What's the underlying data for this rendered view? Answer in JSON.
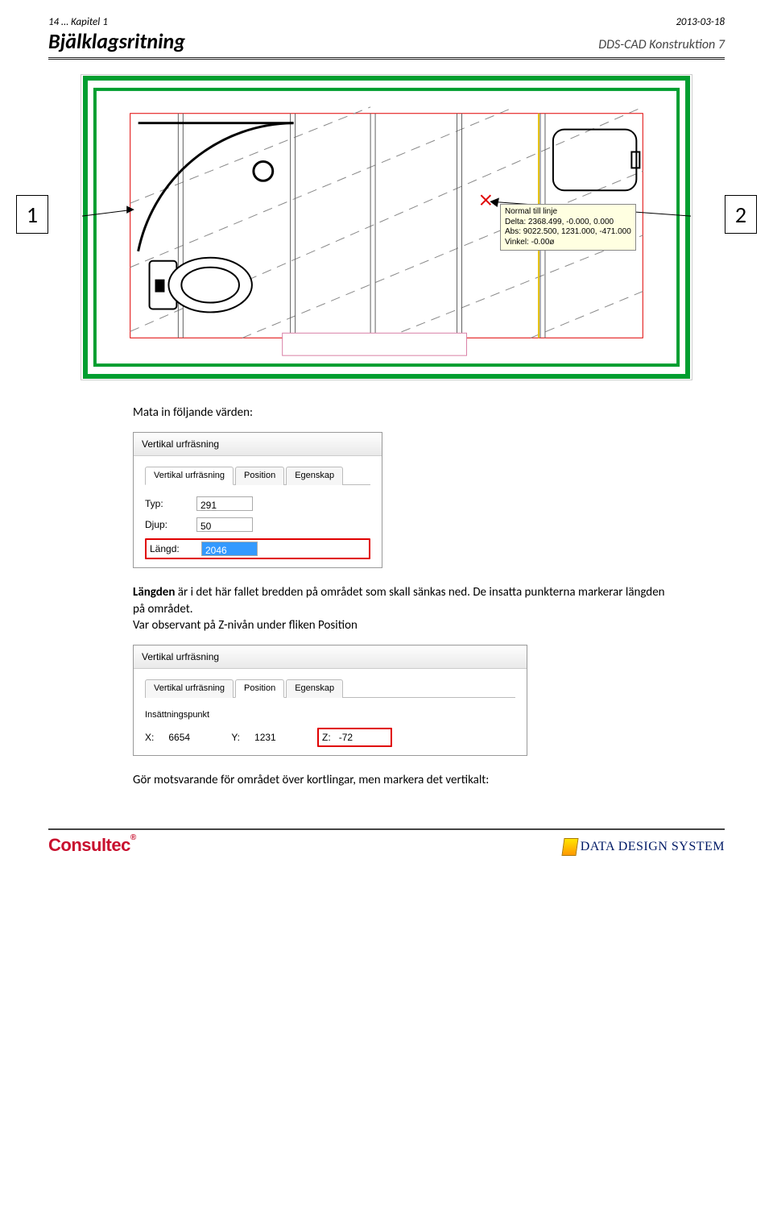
{
  "header": {
    "page_chapter": "14 … Kapitel 1",
    "date": "2013-03-18",
    "title_left": "Bjälklagsritning",
    "title_right": "DDS-CAD Konstruktion 7"
  },
  "callouts": {
    "one": "1",
    "two": "2"
  },
  "tooltip": {
    "l1": "Normal till linje",
    "l2": "Delta: 2368.499, -0.000, 0.000",
    "l3": "Abs: 9022.500, 1231.000, -471.000",
    "l4": "Vinkel: -0.00ø"
  },
  "text": {
    "intro": "Mata in följande värden:",
    "langden_label": "Längden",
    "langden_rest": " är i det här fallet bredden på området som skall sänkas ned. De insatta punkterna markerar längden på området.",
    "z_note": "Var observant på Z-nivån under fliken Position",
    "avslut": "Gör motsvarande för området över kortlingar, men markera det vertikalt:"
  },
  "dlg1": {
    "title": "Vertikal urfräsning",
    "tabs": {
      "a": "Vertikal urfräsning",
      "b": "Position",
      "c": "Egenskap"
    },
    "typ_label": "Typ:",
    "typ_val": "291",
    "djup_label": "Djup:",
    "djup_val": "50",
    "langd_label": "Längd:",
    "langd_val": "2046"
  },
  "dlg2": {
    "title": "Vertikal urfräsning",
    "tabs": {
      "a": "Vertikal urfräsning",
      "b": "Position",
      "c": "Egenskap"
    },
    "group": "Insättningspunkt",
    "x_label": "X:",
    "x_val": "6654",
    "y_label": "Y:",
    "y_val": "1231",
    "z_label": "Z:",
    "z_val": "-72"
  },
  "footer": {
    "left": "Consultec",
    "reg": "®",
    "right": "DATA DESIGN SYSTEM"
  }
}
